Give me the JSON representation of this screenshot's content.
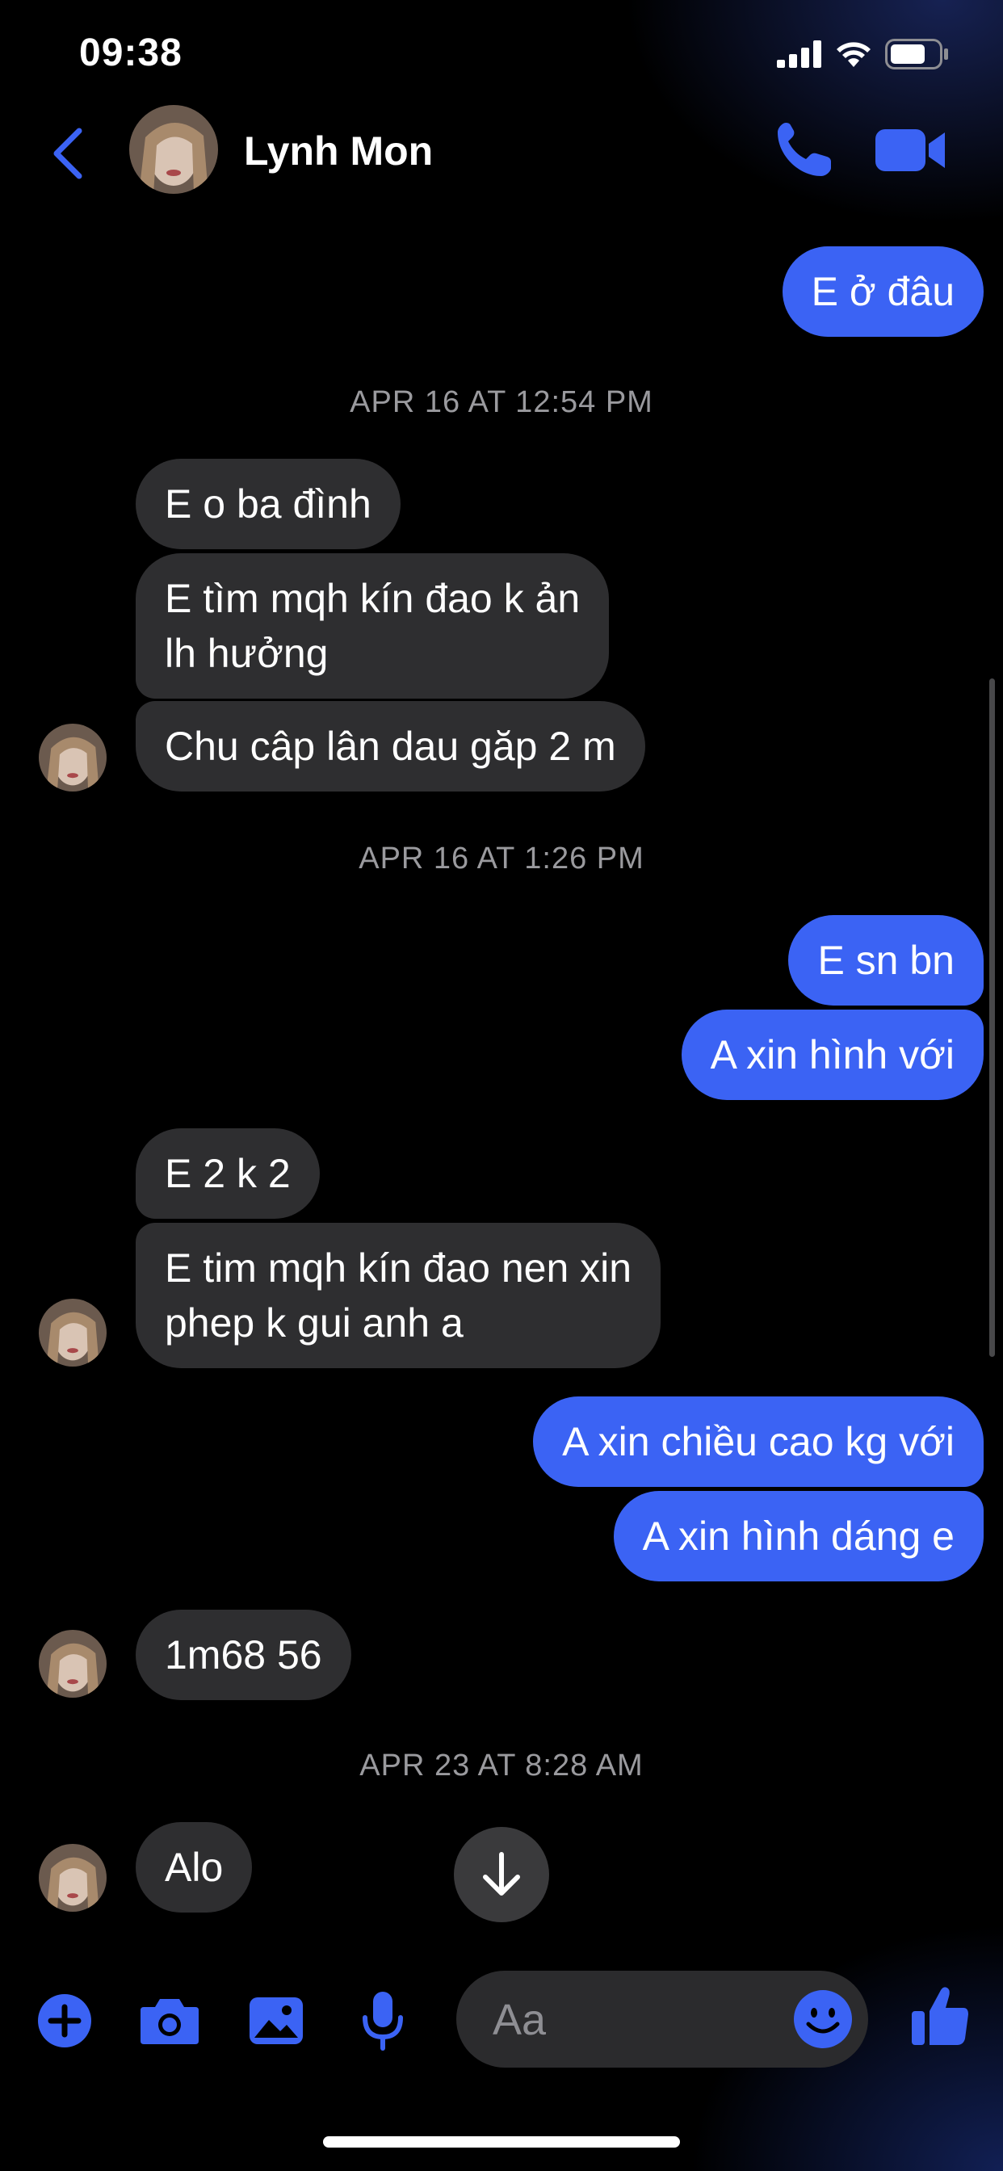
{
  "status_bar": {
    "time": "09:38"
  },
  "header": {
    "contact_name": "Lynh Mon"
  },
  "timestamps": [
    "APR 16 AT 12:54 PM",
    "APR 16 AT 1:26 PM",
    "APR 23 AT 8:28 AM"
  ],
  "messages": [
    {
      "dir": "out",
      "lines": [
        "E ở đâu"
      ]
    },
    {
      "dir": "in",
      "lines": [
        "E o ba đình"
      ]
    },
    {
      "dir": "in",
      "lines": [
        "E tìm mqh kín đao k ản",
        "lh hưởng"
      ]
    },
    {
      "dir": "in",
      "lines": [
        "Chu câp lân dau găp 2 m"
      ]
    },
    {
      "dir": "out",
      "lines": [
        "E sn bn"
      ]
    },
    {
      "dir": "out",
      "lines": [
        "A xin hình với"
      ]
    },
    {
      "dir": "in",
      "lines": [
        "E 2 k 2"
      ]
    },
    {
      "dir": "in",
      "lines": [
        "E tim mqh kín đao nen xin",
        "phep k gui anh a"
      ]
    },
    {
      "dir": "out",
      "lines": [
        "A xin chiều cao kg với"
      ]
    },
    {
      "dir": "out",
      "lines": [
        "A xin hình dáng e"
      ]
    },
    {
      "dir": "in",
      "lines": [
        "1m68 56"
      ]
    },
    {
      "dir": "in",
      "lines": [
        "Alo"
      ]
    }
  ],
  "composer": {
    "placeholder": "Aa"
  },
  "icons": {
    "header": [
      "back-chevron-icon",
      "phone-icon",
      "video-camera-icon"
    ],
    "composer": [
      "plus-icon",
      "camera-icon",
      "photo-icon",
      "microphone-icon",
      "emoji-icon",
      "thumbs-up-icon"
    ],
    "other": [
      "arrow-down-icon"
    ]
  },
  "colors": {
    "accent": "#3b63f4",
    "incoming_bubble": "#2e2e30",
    "background": "#000000",
    "timestamp": "#9a9a9e"
  }
}
